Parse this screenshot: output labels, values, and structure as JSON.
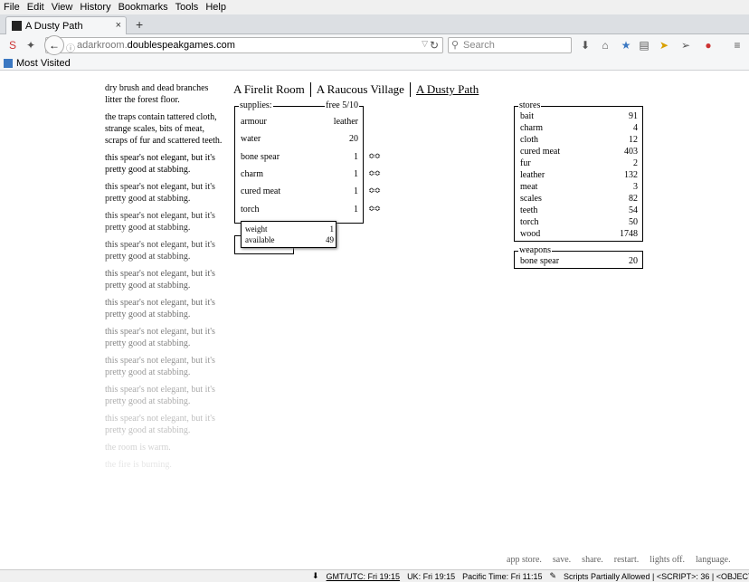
{
  "menu": [
    "File",
    "Edit",
    "View",
    "History",
    "Bookmarks",
    "Tools",
    "Help"
  ],
  "tab": {
    "title": "A Dusty Path"
  },
  "url": {
    "prefix": "adarkroom.",
    "domain": "doublespeakgames.com"
  },
  "search": {
    "placeholder": "Search"
  },
  "bookmarks": {
    "label": "Most Visited"
  },
  "notifications": [
    {
      "text": "dry brush and dead branches litter the forest floor.",
      "opacity": 1
    },
    {
      "text": "the traps contain tattered cloth, strange scales, bits of meat, scraps of fur and scattered teeth.",
      "opacity": 1
    },
    {
      "text": "this spear's not elegant, but it's pretty good at stabbing.",
      "opacity": 1
    },
    {
      "text": "this spear's not elegant, but it's pretty good at stabbing.",
      "opacity": 0.9
    },
    {
      "text": "this spear's not elegant, but it's pretty good at stabbing.",
      "opacity": 0.82
    },
    {
      "text": "this spear's not elegant, but it's pretty good at stabbing.",
      "opacity": 0.74
    },
    {
      "text": "this spear's not elegant, but it's pretty good at stabbing.",
      "opacity": 0.66
    },
    {
      "text": "this spear's not elegant, but it's pretty good at stabbing.",
      "opacity": 0.58
    },
    {
      "text": "this spear's not elegant, but it's pretty good at stabbing.",
      "opacity": 0.5
    },
    {
      "text": "this spear's not elegant, but it's pretty good at stabbing.",
      "opacity": 0.42
    },
    {
      "text": "this spear's not elegant, but it's pretty good at stabbing.",
      "opacity": 0.34
    },
    {
      "text": "this spear's not elegant, but it's pretty good at stabbing.",
      "opacity": 0.26
    },
    {
      "text": "the room is warm.",
      "opacity": 0.18
    },
    {
      "text": "the fire is burning.",
      "opacity": 0.1
    }
  ],
  "locations": {
    "room": "A Firelit Room",
    "village": "A Raucous Village",
    "path": "A Dusty Path"
  },
  "supplies": {
    "legend": "supplies:",
    "free": "free 5/10",
    "items": [
      {
        "name": "armour",
        "value": "leather"
      },
      {
        "name": "water",
        "value": "20"
      },
      {
        "name": "bone spear",
        "value": "1"
      },
      {
        "name": "charm",
        "value": "1"
      },
      {
        "name": "cured meat",
        "value": "1"
      },
      {
        "name": "torch",
        "value": "1"
      }
    ]
  },
  "tooltip": {
    "weight_label": "weight",
    "weight_value": "1",
    "available_label": "available",
    "available_value": "49"
  },
  "stores": {
    "legend": "stores",
    "items": [
      {
        "name": "bait",
        "value": "91"
      },
      {
        "name": "charm",
        "value": "4"
      },
      {
        "name": "cloth",
        "value": "12"
      },
      {
        "name": "cured meat",
        "value": "403"
      },
      {
        "name": "fur",
        "value": "2"
      },
      {
        "name": "leather",
        "value": "132"
      },
      {
        "name": "meat",
        "value": "3"
      },
      {
        "name": "scales",
        "value": "82"
      },
      {
        "name": "teeth",
        "value": "54"
      },
      {
        "name": "torch",
        "value": "50"
      },
      {
        "name": "wood",
        "value": "1748"
      }
    ]
  },
  "weapons": {
    "legend": "weapons",
    "items": [
      {
        "name": "bone spear",
        "value": "20"
      }
    ]
  },
  "footer": [
    "app store.",
    "save.",
    "share.",
    "restart.",
    "lights off.",
    "language."
  ],
  "status": {
    "gmt": "GMT/UTC: Fri 19:15",
    "uk": "UK: Fri 19:15",
    "pacific": "Pacific Time: Fri 11:15",
    "scripts": "Scripts Partially Allowed | <SCRIPT>: 36 | <OBJECT>: 0"
  }
}
